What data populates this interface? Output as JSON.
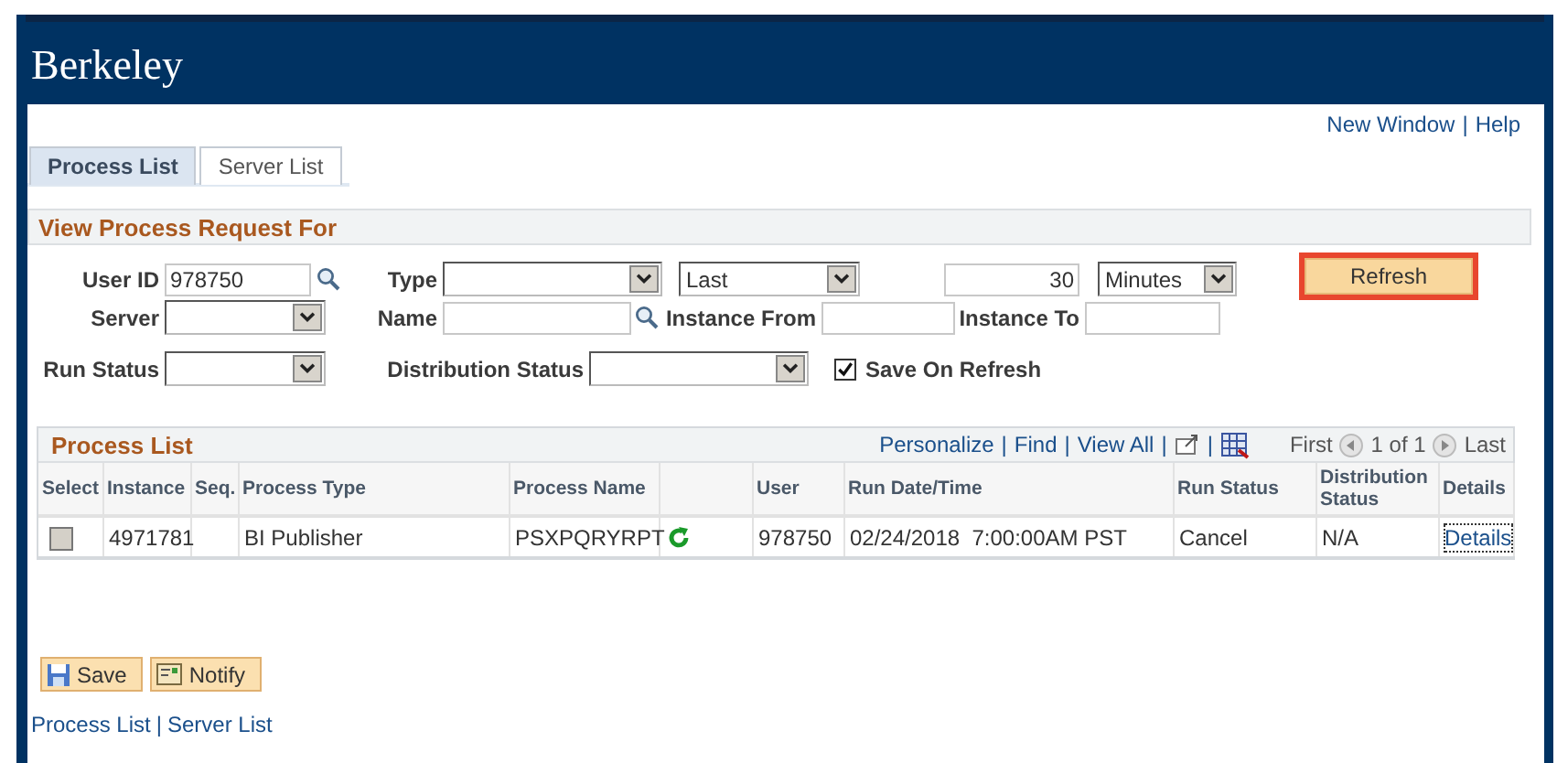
{
  "header": {
    "logo": "Berkeley"
  },
  "link_separator": "|",
  "top_links": [
    "New Window",
    "Help"
  ],
  "tabs": [
    {
      "label": "Process List",
      "selected": true
    },
    {
      "label": "Server List",
      "selected": false
    }
  ],
  "filter_panel": {
    "title": "View Process Request For",
    "user_id": {
      "label": "User ID",
      "value": "978750"
    },
    "type": {
      "label": "Type"
    },
    "period": {
      "qualifier": "Last",
      "amount": "30",
      "unit": "Minutes"
    },
    "refresh_button": {
      "label": "Refresh",
      "highlighted": true
    },
    "server": {
      "label": "Server"
    },
    "name": {
      "label": "Name"
    },
    "instance_from": {
      "label": "Instance From"
    },
    "instance_to": {
      "label": "Instance To"
    },
    "run_status": {
      "label": "Run Status"
    },
    "distribution_status": {
      "label": "Distribution Status"
    },
    "save_on_refresh": {
      "label": "Save On Refresh",
      "checked": true
    }
  },
  "process_list": {
    "title": "Process List",
    "toolbar_links": [
      "Personalize",
      "Find",
      "View All"
    ],
    "pager": {
      "first": "First",
      "range": "1 of 1",
      "last": "Last"
    },
    "columns": [
      "Select",
      "Instance",
      "Seq.",
      "Process Type",
      "Process Name",
      "User",
      "Run Date/Time",
      "Run Status",
      "Distribution Status",
      "Details"
    ],
    "rows": [
      {
        "selected": false,
        "instance": "4971781",
        "process_type": "BI Publisher",
        "process_name": "PSXPQRYRPT",
        "user": "978750",
        "run_datetime": "02/24/2018  7:00:00AM PST",
        "run_status": "Cancel",
        "distribution_status": "N/A",
        "details": "Details"
      }
    ]
  },
  "actions": [
    {
      "label": "Save",
      "kind": "save"
    },
    {
      "label": "Notify",
      "kind": "notify"
    }
  ],
  "footer_links": [
    "Process List",
    "Server List"
  ]
}
